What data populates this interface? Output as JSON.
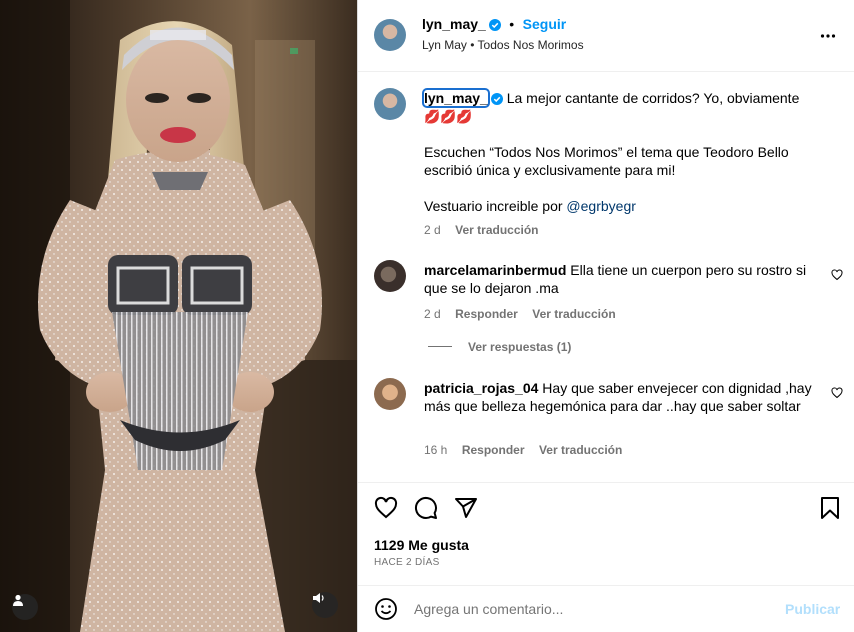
{
  "colors": {
    "accent": "#0095f6",
    "link": "#00376b",
    "muted": "#737373",
    "divider": "#dbdbdb",
    "lips": "#e6394b"
  },
  "media": {
    "user_tag_icon": "user-icon",
    "sound_icon": "speaker-icon"
  },
  "header": {
    "username": "lyn_may_",
    "verified_icon": "verified-badge-icon",
    "follow_label": "Seguir",
    "separator": "•",
    "subtitle": "Lyn May • Todos Nos Morimos",
    "more_icon": "more-options-icon"
  },
  "caption": {
    "username": "lyn_may_",
    "text_line1": "La mejor cantante de corridos? Yo, obviamente",
    "emoji": "💋💋💋",
    "paragraph2": "Escuchen “Todos Nos Morimos” el tema que Teodoro Bello escribió única y exclusivamente para mi!",
    "paragraph3_prefix": "Vestuario increible por",
    "mention": "@egrbyegr",
    "time": "2 d",
    "translate": "Ver traducción"
  },
  "comments": [
    {
      "username": "marcelamarinbermud",
      "text": "Ella tiene un cuerpon pero su rostro si que se lo dejaron .ma",
      "time": "2 d",
      "reply": "Responder",
      "translate": "Ver traducción",
      "view_replies": "Ver respuestas (1)"
    },
    {
      "username": "patricia_rojas_04",
      "text": "Hay que saber envejecer con dignidad ,hay más que belleza hegemónica para dar ..hay que saber soltar",
      "time": "16 h",
      "reply": "Responder",
      "translate": "Ver traducción"
    }
  ],
  "actions": {
    "like_icon": "heart-icon",
    "comment_icon": "comment-icon",
    "share_icon": "share-icon",
    "save_icon": "bookmark-icon",
    "likes": "1129 Me gusta",
    "date": "HACE 2 DÍAS"
  },
  "composer": {
    "emoji_icon": "emoji-icon",
    "placeholder": "Agrega un comentario...",
    "post_label": "Publicar"
  }
}
